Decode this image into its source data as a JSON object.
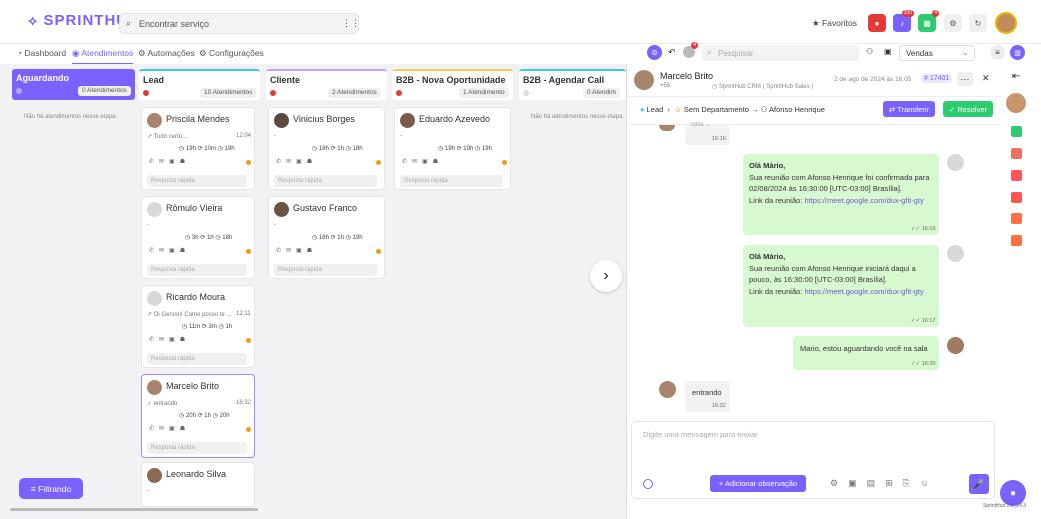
{
  "app": {
    "logo": "SPRINTHUB",
    "version": "SprintHub 2.6_24.3"
  },
  "search": {
    "placeholder": "Encontrar serviço"
  },
  "topbar": {
    "favorites": "Favoritos",
    "badge_notif": "330",
    "badge_apps": "4"
  },
  "nav": {
    "dashboard": "Dashboard",
    "atendimentos": "Atendimentos",
    "automacoes": "Automações",
    "configuracoes": "Configurações"
  },
  "toolbar": {
    "badge": "4",
    "search_placeholder": "Pesquisar",
    "select": "Vendas"
  },
  "columns": [
    {
      "title": "Aguardando",
      "count": "0 Atendimentos",
      "empty": "Não há atendimentos nesse etapa."
    },
    {
      "title": "Lead",
      "count": "10 Atendimentos"
    },
    {
      "title": "Cliente",
      "count": "2 Atendimentos"
    },
    {
      "title": "B2B - Nova Oportunidade",
      "count": "1 Atendimento"
    },
    {
      "title": "B2B - Agendar Call",
      "count": "0 Atendim",
      "empty": "Não há atendimentos nesse etapa."
    }
  ],
  "cards": {
    "priscila": {
      "name": "Priscila Mendes",
      "preview": "Tudo certo...",
      "time": "12:04",
      "s1": "19h",
      "s2": "10m",
      "s3": "19h"
    },
    "romulo": {
      "name": "Rômulo Vieira",
      "preview": "-",
      "s1": "3h",
      "s2": "1h",
      "s3": "18h"
    },
    "ricardo": {
      "name": "Ricardo Moura",
      "preview": "Oi Gerson! Como posso te ...",
      "time": "12:11",
      "s1": "11m",
      "s2": "3m",
      "s3": "1h"
    },
    "marcelo": {
      "name": "Marcelo Brito",
      "preview": "entrando",
      "time": "16:32",
      "s1": "20h",
      "s2": "1h",
      "s3": "20h"
    },
    "leonardo": {
      "name": "Leonardo Silva",
      "preview": "-"
    },
    "vinicius": {
      "name": "Vinicius Borges",
      "preview": "-",
      "s1": "18h",
      "s2": "1h",
      "s3": "18h"
    },
    "gustavo": {
      "name": "Gustavo Franco",
      "preview": "-",
      "s1": "18h",
      "s2": "1h",
      "s3": "19h"
    },
    "eduardo": {
      "name": "Eduardo Azevedo",
      "preview": "-",
      "s1": "19h",
      "s2": "19h",
      "s3": "19h"
    },
    "quick_reply": "Resposta rápida"
  },
  "filter_button": "Filtrando",
  "chat": {
    "name": "Marcelo Brito",
    "phone": "+55",
    "source": "SprintHub CRM ( SprintHub Sales )",
    "date": "2 de ago de 2024 às 16:05",
    "ticket": "# 17401",
    "stage": "Lead",
    "department": "Sem Departamento",
    "agent": "Afonso Henrique",
    "transfer": "Transferir",
    "resolve": "Resolver",
    "cut_text": "cons ...",
    "cut_time": "16:16",
    "m1_title": "Olá Mário,",
    "m1_body": "Sua reunião com Afonso Henrique foi confirmada para 02/08/2024 às 16:30:00 [UTC-03:00] Brasília].",
    "m1_link_label": "Link da reunião:",
    "m1_link": "https://meet.google.com/dux-gfit-gty",
    "m1_time": "16:16",
    "m2_title": "Olá Mário,",
    "m2_body": "Sua reunião com Afonso Henrique iniciará daqui a pouco, às 16:30:00 [UTC-03:00] Brasília].",
    "m2_link_label": "Link da reunião:",
    "m2_link": "https://meet.google.com/dux-gfit-gty",
    "m2_time": "16:17",
    "m3": "Mario, estou aguardando você na sala",
    "m3_time": "16:30",
    "m4": "entrando",
    "m4_time": "16:32",
    "input_placeholder": "Digite uma mensagem para enviar",
    "add_note": "+ Adicionar observação"
  },
  "colors": {
    "accent": "#7b61ff",
    "green": "#2ecc71",
    "msg_green": "#d7f9d0"
  }
}
